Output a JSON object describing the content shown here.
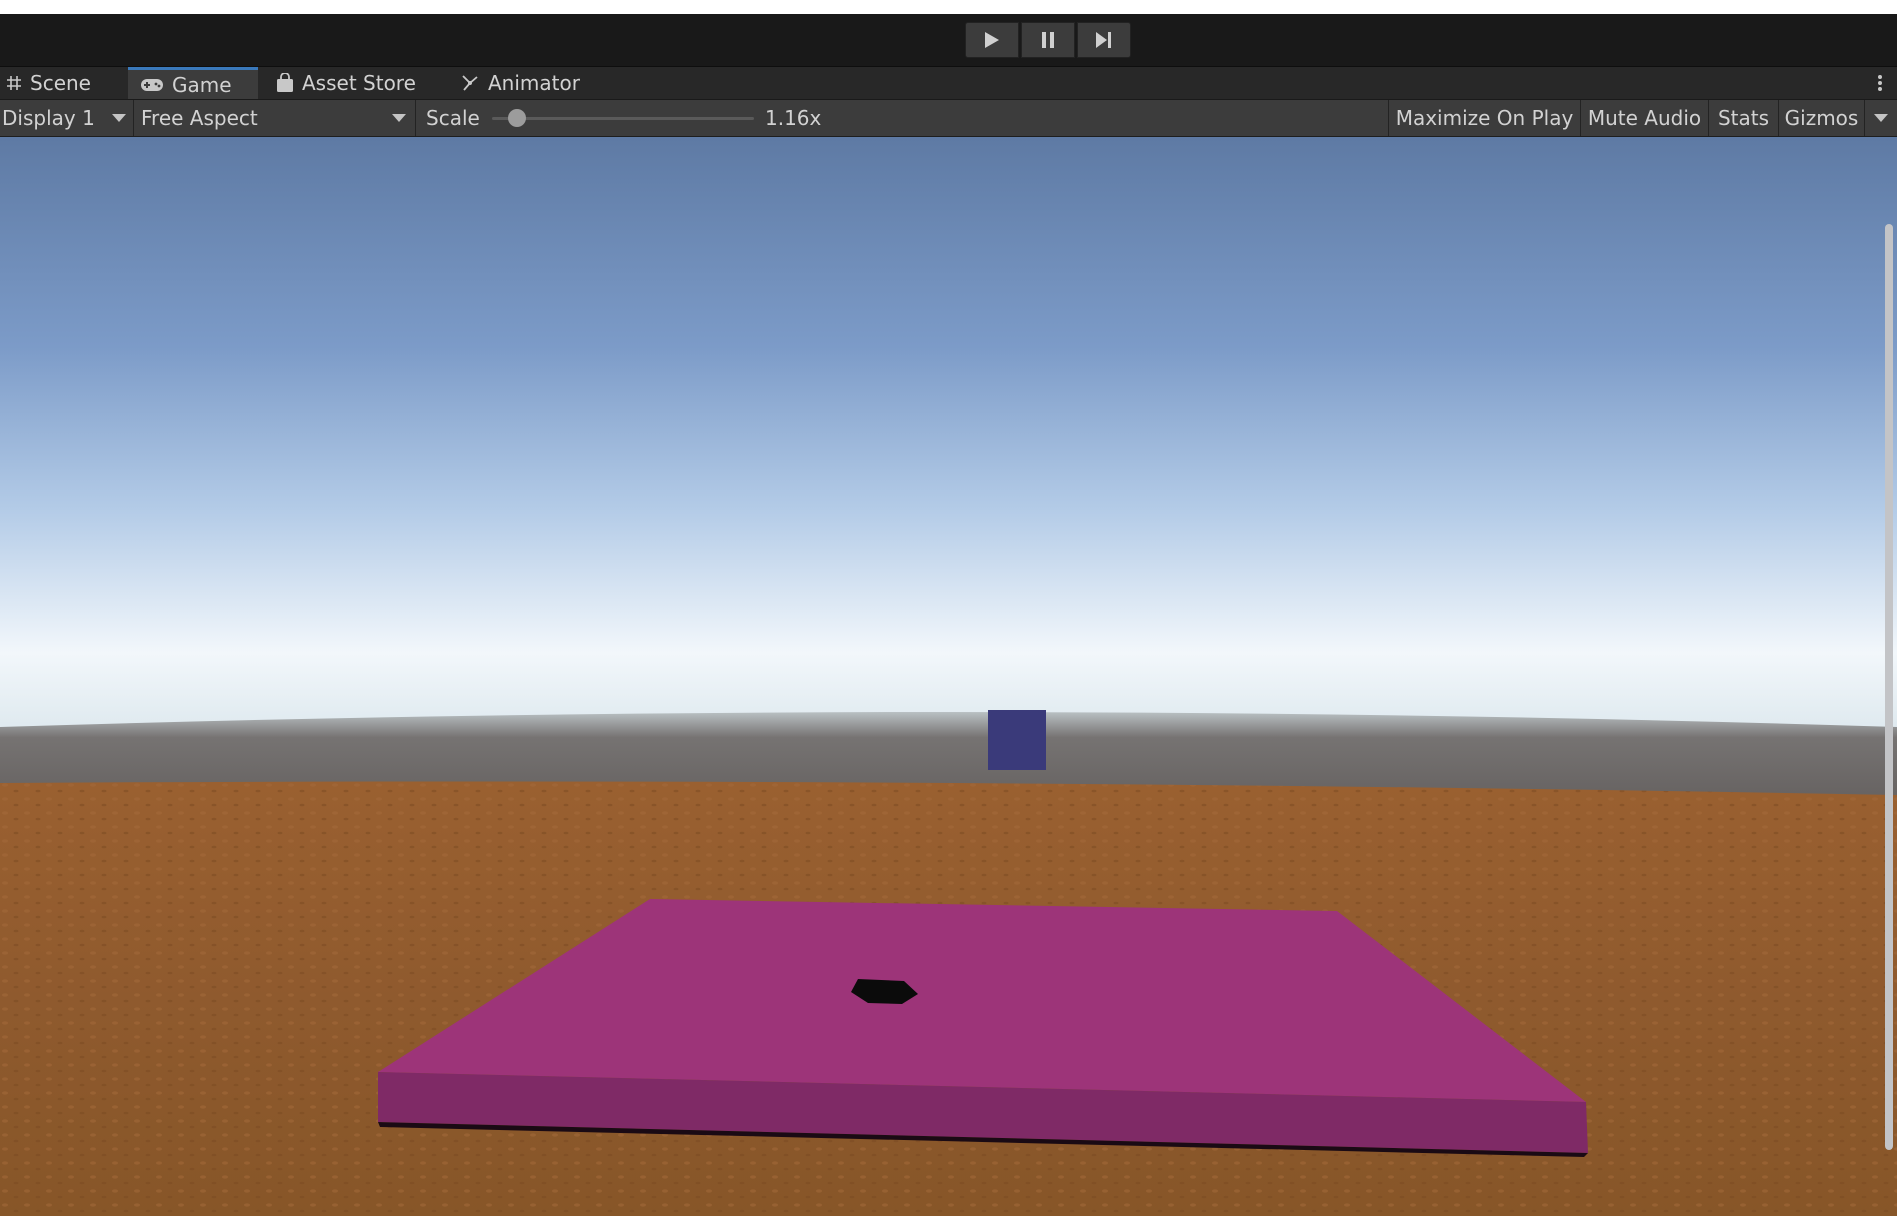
{
  "playbar": {
    "buttons": [
      {
        "icon": "play-icon"
      },
      {
        "icon": "pause-icon"
      },
      {
        "icon": "step-icon"
      }
    ]
  },
  "tabs": [
    {
      "label": "Scene",
      "icon": "grid-icon"
    },
    {
      "label": "Game",
      "icon": "gamepad-icon",
      "active": true
    },
    {
      "label": "Asset Store",
      "icon": "shopping-bag-icon"
    },
    {
      "label": "Animator",
      "icon": "animator-icon"
    }
  ],
  "toolbar": {
    "display": "Display 1",
    "aspect": "Free Aspect",
    "scale_label": "Scale",
    "scale_value": "1.16x",
    "maximize_on_play": "Maximize On Play",
    "mute_audio": "Mute Audio",
    "stats": "Stats",
    "gizmos": "Gizmos"
  },
  "colors": {
    "sky_top": "#5e7aa4",
    "sky_horizon": "#f2f7fb",
    "ground": "#9a6030",
    "platform_top": "#9d3479",
    "platform_side": "#7f2a66",
    "cube": "#3a3a7a",
    "accent_tab": "#3a79bb"
  }
}
